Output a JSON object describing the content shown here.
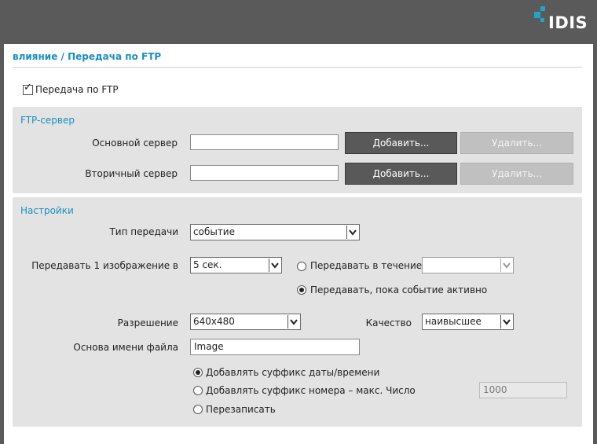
{
  "brand": {
    "name": "IDIS",
    "accent": "#26a3c6"
  },
  "page": {
    "title": "влияние / Передача по FTP"
  },
  "ftp_enable": {
    "label": "Передача по FTP",
    "checked": true
  },
  "ftp_server": {
    "title": "FTP-сервер",
    "primary_label": "Основной сервер",
    "primary_value": "",
    "secondary_label": "Вторичный сервер",
    "secondary_value": "",
    "add_label": "Добавить...",
    "remove_label": "Удалить..."
  },
  "settings": {
    "title": "Настройки",
    "transfer_type_label": "Тип передачи",
    "transfer_type_value": "событие",
    "interval_label": "Передавать 1 изображение в",
    "interval_value": "5 сек.",
    "during_label": "Передавать в течение",
    "during_value": "",
    "while_active_label": "Передавать, пока событие активно",
    "transfer_mode_selected": "while_active",
    "resolution_label": "Разрешение",
    "resolution_value": "640x480",
    "quality_label": "Качество",
    "quality_value": "наивысшее",
    "filename_label": "Основа имени файла",
    "filename_value": "Image",
    "suffix_datetime_label": "Добавлять суффикс даты/времени",
    "suffix_number_label": "Добавлять суффикс номера – макс. Число",
    "suffix_number_max": "1000",
    "overwrite_label": "Перезаписать",
    "suffix_selected": "datetime"
  }
}
